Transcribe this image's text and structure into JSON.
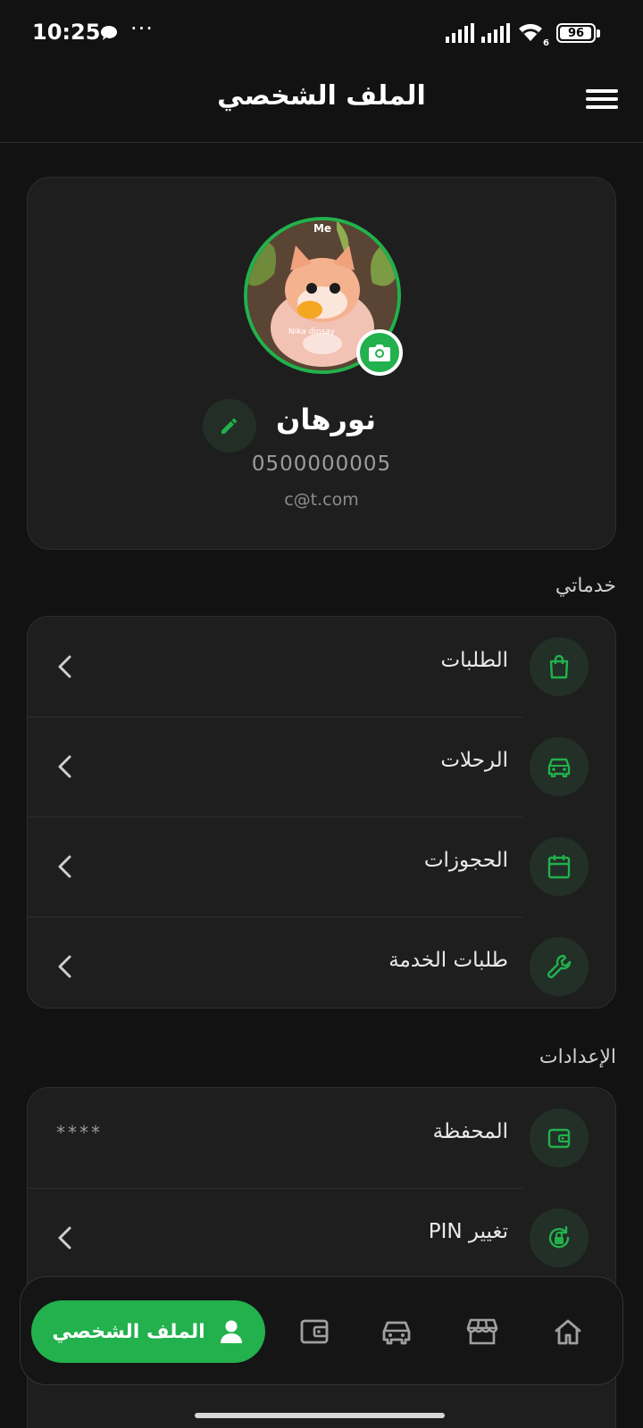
{
  "status_bar": {
    "time": "10:25",
    "more": "···",
    "network_badge": "6",
    "battery_level": "96",
    "battery_fraction": 0.96
  },
  "header": {
    "title": "الملف الشخصي",
    "menu_icon": "hamburger-menu-icon"
  },
  "profile": {
    "name": "نورهان",
    "phone": "0500000005",
    "email": "c@t.com",
    "avatar_badge": "Me",
    "avatar_caption": "Nika dinsay"
  },
  "services": {
    "title": "خدماتي",
    "items": [
      {
        "label": "الطلبات",
        "icon": "shopping-bag-icon"
      },
      {
        "label": "الرحلات",
        "icon": "car-icon"
      },
      {
        "label": "الحجوزات",
        "icon": "calendar-icon"
      },
      {
        "label": "طلبات الخدمة",
        "icon": "wrench-icon"
      }
    ]
  },
  "settings": {
    "title": "الإعدادات",
    "items": [
      {
        "label": "المحفظة",
        "icon": "wallet-icon",
        "value": "****"
      },
      {
        "label": "تغيير PIN",
        "icon": "pin-reset-icon"
      }
    ]
  },
  "bottom_nav": {
    "active_label": "الملف الشخصي",
    "items": [
      "profile-icon",
      "wallet-icon",
      "car-icon",
      "store-icon",
      "home-icon"
    ]
  },
  "colors": {
    "accent": "#22b14c",
    "background": "#121212",
    "card": "#1e1e1e"
  }
}
